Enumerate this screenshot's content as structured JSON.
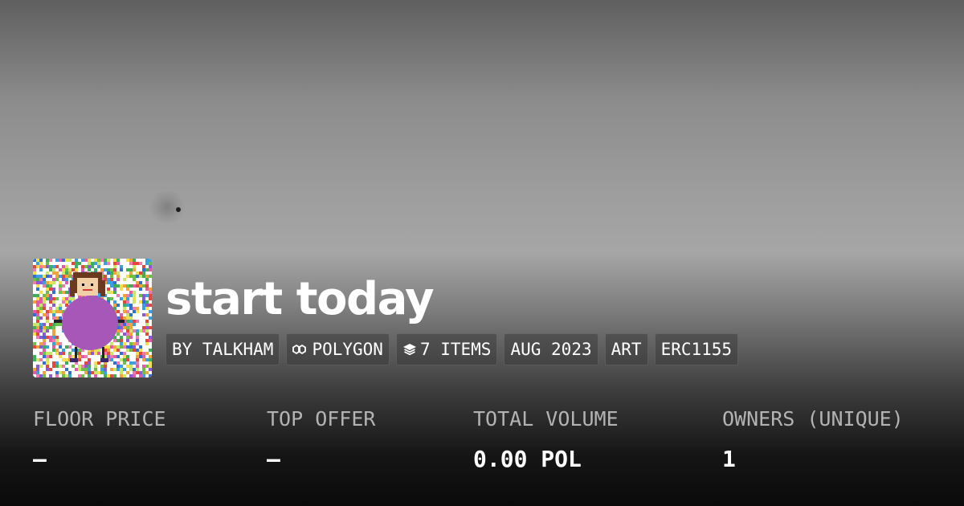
{
  "collection": {
    "name": "start today",
    "tags": {
      "creator": "BY TALKHAM",
      "chain": "POLYGON",
      "items": "7 ITEMS",
      "date": "AUG 2023",
      "category": "ART",
      "standard": "ERC1155"
    },
    "icons": {
      "chain": "polygon-icon",
      "items": "layers-icon"
    }
  },
  "stats": [
    {
      "label": "FLOOR PRICE",
      "value": "–"
    },
    {
      "label": "TOP OFFER",
      "value": "–"
    },
    {
      "label": "TOTAL VOLUME",
      "value": "0.00 POL"
    },
    {
      "label": "OWNERS (UNIQUE)",
      "value": "1"
    }
  ]
}
